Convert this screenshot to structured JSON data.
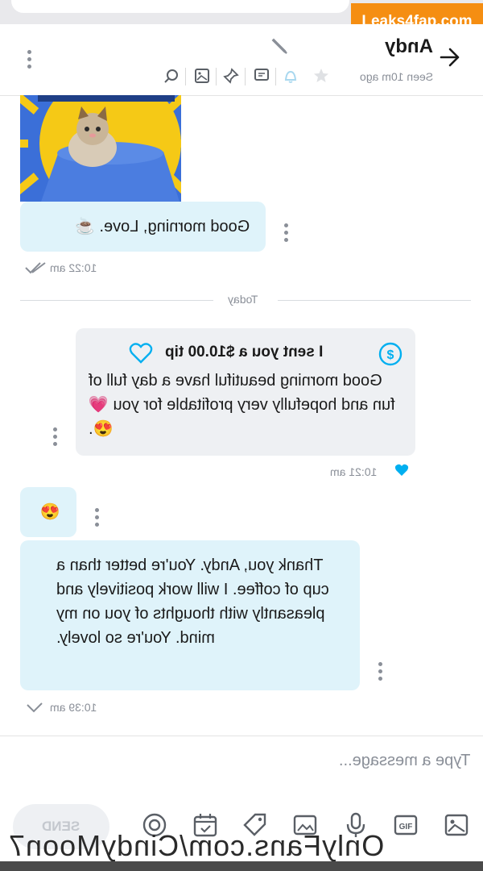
{
  "watermark": "Leaks4fap.com",
  "header": {
    "name": "Andy",
    "seen": "Seen 10m ago",
    "icons": [
      "search-icon",
      "image-icon",
      "pin-icon",
      "message-icon",
      "bell-icon",
      "star-icon",
      "edit-icon",
      "back-arrow-icon",
      "more-icon"
    ]
  },
  "messages": {
    "m1": {
      "text": "Good morning, Love. ☕",
      "time": "10:22 am"
    },
    "divider": "Today",
    "tip": {
      "title": "I sent you a $10.00 tip",
      "text": "Good morning beautiful have a day full of fun and hopefully very profitable for you 💗 😍.",
      "time": "10:21 am"
    },
    "m2": {
      "text": "😍"
    },
    "m3": {
      "text": "Thank you, Andy. You're better than a cup of coffee. I will work positively and pleasantly with thoughts of you on my mind. You're so lovely.",
      "time": "10:39 am"
    }
  },
  "compose": {
    "placeholder": "Type a message...",
    "send": "SEND",
    "tools": [
      "image-icon",
      "gif-icon",
      "mic-icon",
      "gallery-icon",
      "tag-icon",
      "calendar-icon",
      "poll-icon"
    ]
  },
  "footer": "OnlyFans.com/CindyMoon7",
  "colors": {
    "accent": "#00aff0",
    "incoming": "#dff3fa",
    "outgoing": "#eef0f3",
    "watermark": "#f58e12"
  }
}
